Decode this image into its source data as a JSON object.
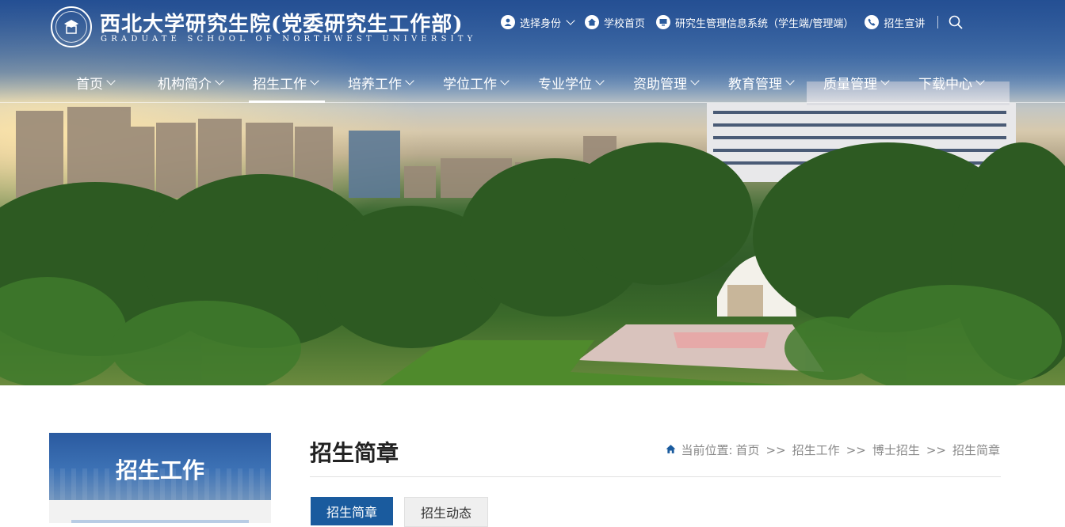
{
  "brand": {
    "name_cn": "西北大学研究生院(党委研究生工作部)",
    "name_en": "GRADUATE SCHOOL OF NORTHWEST UNIVERSITY"
  },
  "top_links": [
    {
      "label": "选择身份",
      "icon": "user-icon"
    },
    {
      "label": "学校首页",
      "icon": "home-icon"
    },
    {
      "label": "研究生管理信息系统（学生端/管理端）",
      "icon": "monitor-icon"
    },
    {
      "label": "招生宣讲",
      "icon": "phone-icon"
    }
  ],
  "nav": [
    "首页",
    "机构简介",
    "招生工作",
    "培养工作",
    "学位工作",
    "专业学位",
    "资助管理",
    "教育管理",
    "质量管理",
    "下载中心"
  ],
  "nav_active": "招生工作",
  "sidebar": {
    "title": "招生工作"
  },
  "content": {
    "title": "招生简章",
    "breadcrumb_prefix": "当前位置:",
    "breadcrumb": [
      "首页",
      "招生工作",
      "博士招生",
      "招生简章"
    ],
    "breadcrumb_sep": ">>",
    "tabs": [
      "招生简章",
      "招生动态"
    ]
  }
}
